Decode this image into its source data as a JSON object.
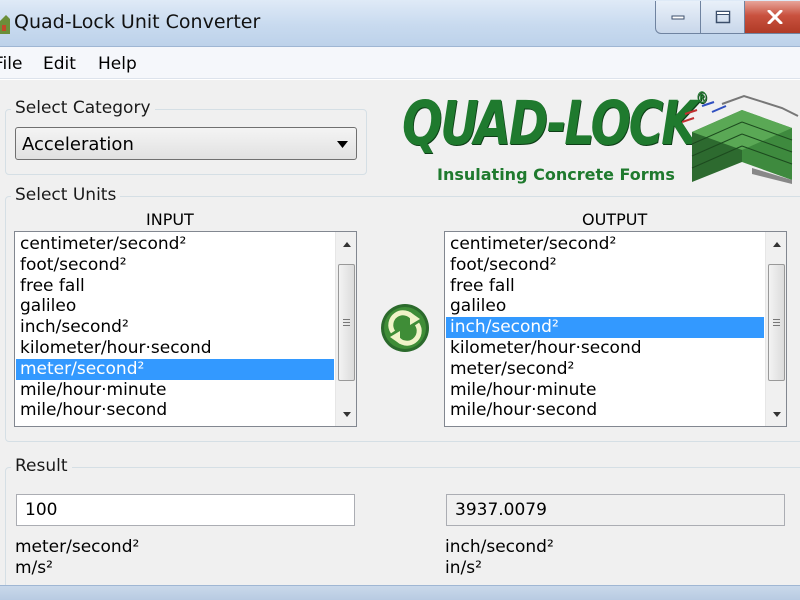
{
  "window": {
    "title": "Quad-Lock Unit Converter"
  },
  "menu": [
    "File",
    "Edit",
    "Help"
  ],
  "category": {
    "label": "Select Category",
    "selected": "Acceleration"
  },
  "logo": {
    "wordmark": "QUAD-LOCK",
    "registered": "®",
    "tagline": "Insulating Concrete Forms"
  },
  "units": {
    "label": "Select Units",
    "input_header": "INPUT",
    "output_header": "OUTPUT",
    "input_items": [
      "centimeter/second²",
      "foot/second²",
      "free fall",
      "galileo",
      "inch/second²",
      "kilometer/hour·second",
      "meter/second²",
      "mile/hour·minute",
      "mile/hour·second"
    ],
    "input_selected_index": 6,
    "output_items": [
      "centimeter/second²",
      "foot/second²",
      "free fall",
      "galileo",
      "inch/second²",
      "kilometer/hour·second",
      "meter/second²",
      "mile/hour·minute",
      "mile/hour·second"
    ],
    "output_selected_index": 4
  },
  "result": {
    "label": "Result",
    "input_value": "100",
    "output_value": "3937.0079",
    "input_unit_name": "meter/second²",
    "input_unit_symbol": "m/s²",
    "output_unit_name": "inch/second²",
    "output_unit_symbol": "in/s²"
  },
  "icons": {
    "app": "house-icon",
    "convert": "recycle-arrows-icon",
    "combo_arrow": "chevron-down-icon"
  },
  "colors": {
    "selection": "#3399ff",
    "logo_green": "#1f7a2e",
    "close_red": "#c9523f"
  }
}
